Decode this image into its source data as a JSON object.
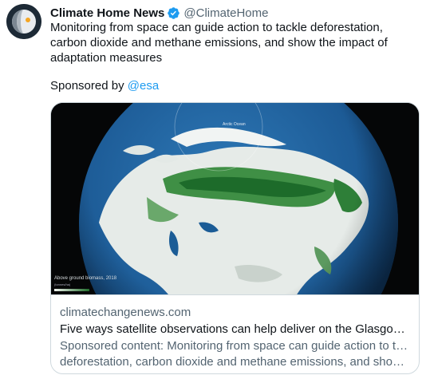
{
  "tweet": {
    "author": {
      "display_name": "Climate Home News",
      "handle": "@ClimateHome",
      "verified": true,
      "avatar_icon": "climate-home-logo-icon"
    },
    "text": "Monitoring from space can guide action to tackle deforestation, carbon dioxide and methane emissions, and show the impact of adaptation measures",
    "sponsored_prefix": "Sponsored by",
    "sponsor_mention": "@esa"
  },
  "card": {
    "image_caption": "Above ground biomass, 2018",
    "image_caption_sub": "(tonnes/ha)",
    "image_label": "Arctic Ocean",
    "domain": "climatechangenews.com",
    "title": "Five ways satellite observations can help deliver on the Glasgow Climate Pact",
    "description_line1": "Sponsored content: Monitoring from space can guide action to tackle",
    "description_line2": "deforestation, carbon dioxide and methane emissions, and show the impact of adaptation measures"
  },
  "colors": {
    "link": "#1d9bf0",
    "secondary_text": "#536471",
    "border": "#cfd9de",
    "verified_badge": "#1d9bf0"
  }
}
